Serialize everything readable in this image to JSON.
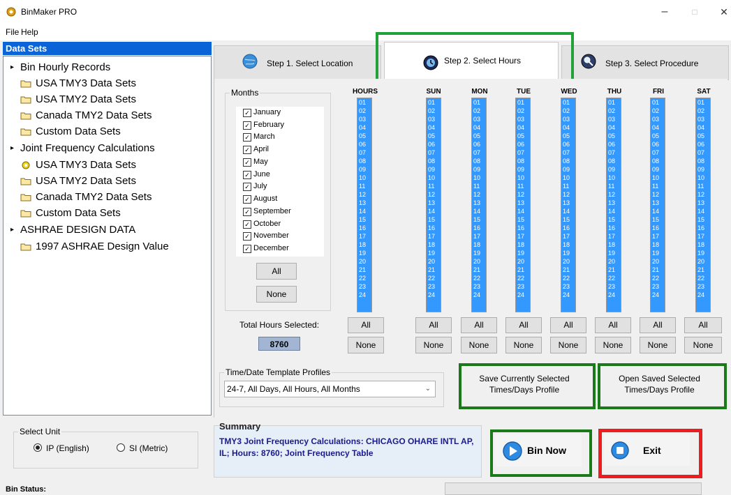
{
  "window": {
    "title": "BinMaker PRO",
    "minimize": "–",
    "maximize": "□",
    "close": "✕"
  },
  "menu": {
    "items": [
      "File",
      "Help"
    ]
  },
  "datasets": {
    "header": "Data Sets",
    "tree": [
      {
        "label": "Bin Hourly Records",
        "type": "group"
      },
      {
        "label": "USA TMY3 Data Sets",
        "type": "folder"
      },
      {
        "label": "USA TMY2 Data Sets",
        "type": "folder"
      },
      {
        "label": "Canada TMY2 Data Sets",
        "type": "folder"
      },
      {
        "label": "Custom Data Sets",
        "type": "folder"
      },
      {
        "label": "Joint Frequency Calculations",
        "type": "group"
      },
      {
        "label": "USA TMY3 Data Sets",
        "type": "selected"
      },
      {
        "label": "USA TMY2 Data Sets",
        "type": "folder"
      },
      {
        "label": "Canada TMY2 Data Sets",
        "type": "folder"
      },
      {
        "label": "Custom Data Sets",
        "type": "folder"
      },
      {
        "label": "ASHRAE DESIGN DATA",
        "type": "group"
      },
      {
        "label": "1997 ASHRAE Design Value",
        "type": "folder"
      }
    ]
  },
  "tabs": [
    {
      "label": "Step 1.  Select Location",
      "icon": "globe-icon"
    },
    {
      "label": "Step 2.  Select Hours",
      "icon": "clock-icon",
      "active": true
    },
    {
      "label": "Step 3.  Select Procedure",
      "icon": "magnifier-icon"
    }
  ],
  "months": {
    "legend": "Months",
    "items": [
      "January",
      "February",
      "March",
      "April",
      "May",
      "June",
      "July",
      "August",
      "September",
      "October",
      "November",
      "December"
    ],
    "checked": true,
    "all_label": "All",
    "none_label": "None"
  },
  "hours_grid": {
    "columns": [
      "HOURS",
      "SUN",
      "MON",
      "TUE",
      "WED",
      "THU",
      "FRI",
      "SAT"
    ],
    "hours": [
      "01",
      "02",
      "03",
      "04",
      "05",
      "06",
      "07",
      "08",
      "09",
      "10",
      "11",
      "12",
      "13",
      "14",
      "15",
      "16",
      "17",
      "18",
      "19",
      "20",
      "21",
      "22",
      "23",
      "24"
    ],
    "all_label": "All",
    "none_label": "None"
  },
  "total": {
    "label": "Total Hours Selected:",
    "value": "8760"
  },
  "template": {
    "legend": "Time/Date Template Profiles",
    "selected": "24-7,  All Days, All Hours, All Months"
  },
  "profile_buttons": {
    "save": "Save Currently Selected Times/Days Profile",
    "open": "Open Saved Selected Times/Days Profile"
  },
  "unit": {
    "legend": "Select Unit",
    "ip": "IP (English)",
    "si": "SI (Metric)",
    "selected": "ip"
  },
  "summary": {
    "title": "Summary",
    "text": "TMY3 Joint Frequency Calculations: CHICAGO OHARE INTL AP, IL; Hours: 8760; Joint Frequency Table"
  },
  "actions": {
    "bin_now": "Bin Now",
    "exit": "Exit"
  },
  "status": {
    "label": "Bin Status:"
  },
  "colors": {
    "accent": "#0a64d8",
    "list_selected": "#3399ff",
    "green_highlight": "#22a13a",
    "red_highlight": "#ee1c1c",
    "summary_text": "#1a1a8c"
  }
}
